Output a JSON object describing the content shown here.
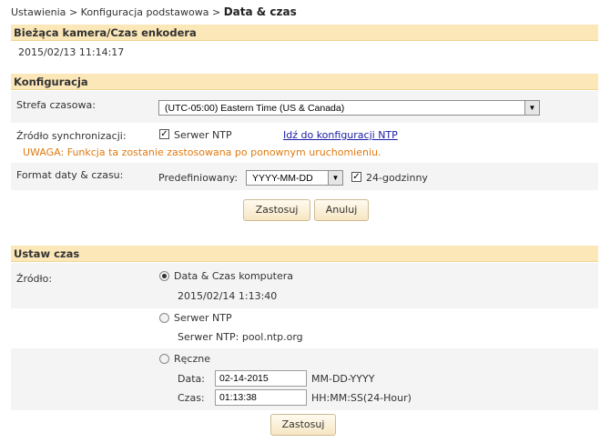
{
  "breadcrumb": {
    "part1": "Ustawienia",
    "sep": ">",
    "part2": "Konfiguracja podstawowa",
    "current": "Data & czas"
  },
  "encoder": {
    "title": "Bieżąca kamera/Czas enkodera",
    "datetime": "2015/02/13 11:14:17"
  },
  "config": {
    "title": "Konfiguracja",
    "timezone_label": "Strefa czasowa:",
    "timezone_value": "(UTC-05:00) Eastern Time (US & Canada)",
    "sync_label": "Źródło synchronizacji:",
    "ntp_checkbox_label": "Serwer NTP",
    "ntp_link": "Idź do konfiguracji NTP",
    "warning": "UWAGA: Funkcja ta zostanie zastosowana po ponownym uruchomieniu.",
    "format_label": "Format daty & czasu:",
    "predefined_label": "Predefiniowany:",
    "date_format_value": "YYYY-MM-DD",
    "hour24_label": "24-godzinny",
    "apply_label": "Zastosuj",
    "cancel_label": "Anuluj"
  },
  "set_time": {
    "title": "Ustaw czas",
    "source_label": "Źródło:",
    "pc_option_label": "Data & Czas komputera",
    "pc_datetime": "2015/02/14 1:13:40",
    "ntp_option_label": "Serwer NTP",
    "ntp_server_text": "Serwer NTP: pool.ntp.org",
    "manual_option_label": "Ręczne",
    "date_label": "Data:",
    "date_value": "02-14-2015",
    "date_format": "MM-DD-YYYY",
    "time_label": "Czas:",
    "time_value": "01:13:38",
    "time_format": "HH:MM:SS(24-Hour)",
    "apply_label": "Zastosuj"
  }
}
